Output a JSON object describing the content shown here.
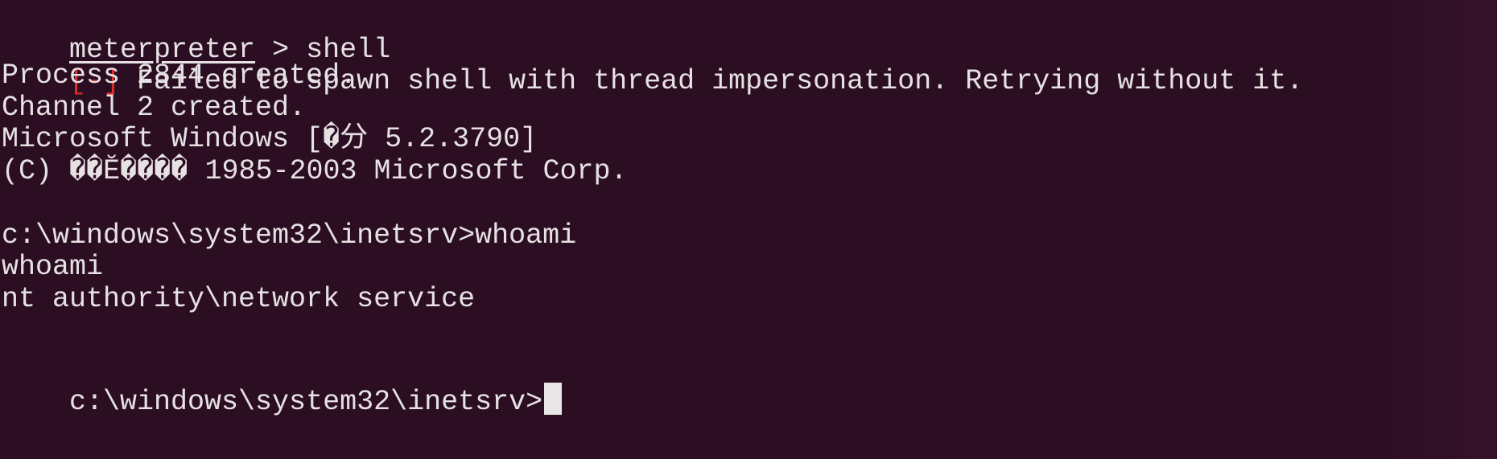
{
  "terminal": {
    "prompt_word": "meterpreter",
    "prompt_rest": " > shell",
    "error_tag": "[-]",
    "error_msg": " Failed to spawn shell with thread impersonation. Retrying without it.",
    "process_line": "Process 2844 created.",
    "channel_line": "Channel 2 created.",
    "windows_version_line": "Microsoft Windows [�分 5.2.3790]",
    "copyright_line": "(C) ��Ĕ���� 1985-2003 Microsoft Corp.",
    "cmd_prompt_1": "c:\\windows\\system32\\inetsrv>whoami",
    "echo_whoami": "whoami",
    "whoami_output": "nt authority\\network service",
    "cmd_prompt_2": "c:\\windows\\system32\\inetsrv>"
  },
  "colors": {
    "background": "#2c0e22",
    "foreground": "#e6e1e3",
    "error": "#e02a2a",
    "cursor": "#e9e6e7"
  }
}
